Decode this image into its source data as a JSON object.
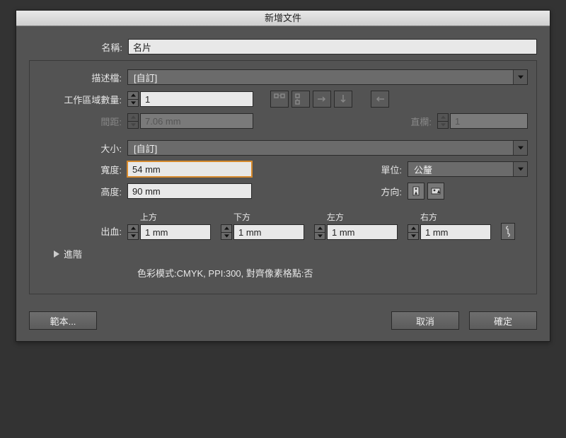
{
  "window": {
    "title": "新增文件"
  },
  "name": {
    "label": "名稱:",
    "value": "名片"
  },
  "profile": {
    "label": "描述檔:",
    "value": "[自訂]"
  },
  "artboards": {
    "label": "工作區域數量:",
    "value": "1"
  },
  "spacing": {
    "label": "間距:",
    "value": "7.06 mm"
  },
  "columns": {
    "label": "直欄:",
    "value": "1"
  },
  "size": {
    "label": "大小:",
    "value": "[自訂]"
  },
  "width": {
    "label": "寬度:",
    "value": "54 mm"
  },
  "height": {
    "label": "高度:",
    "value": "90 mm"
  },
  "units": {
    "label": "單位:",
    "value": "公釐"
  },
  "orientation": {
    "label": "方向:"
  },
  "bleed": {
    "label": "出血:",
    "top": {
      "label": "上方",
      "value": "1 mm"
    },
    "bottom": {
      "label": "下方",
      "value": "1 mm"
    },
    "left": {
      "label": "左方",
      "value": "1 mm"
    },
    "right": {
      "label": "右方",
      "value": "1 mm"
    }
  },
  "advanced": {
    "label": "進階"
  },
  "summary": "色彩模式:CMYK, PPI:300, 對齊像素格點:否",
  "buttons": {
    "template": "範本...",
    "cancel": "取消",
    "ok": "確定"
  }
}
